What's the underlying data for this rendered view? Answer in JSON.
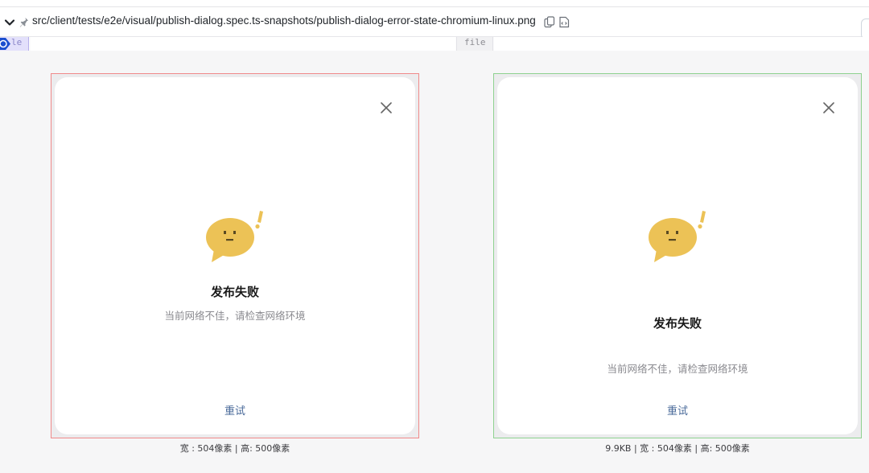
{
  "header": {
    "file_path": "src/client/tests/e2e/visual/publish-dialog.spec.ts-snapshots/publish-dialog-error-state-chromium-linux.png"
  },
  "tabs": {
    "left_label": "le",
    "right_label": "file"
  },
  "left_panel": {
    "dialog": {
      "title": "发布失败",
      "description": "当前网络不佳，请检查网络环境",
      "retry_label": "重试"
    },
    "caption": "宽 : 504像素 | 高: 500像素"
  },
  "right_panel": {
    "dialog": {
      "title": "发布失败",
      "description": "当前网络不佳，请检查网络环境",
      "retry_label": "重试"
    },
    "caption": "9.9KB | 宽 : 504像素 | 高: 500像素"
  },
  "colors": {
    "mascot": "#ecc256",
    "deleted_border": "#f08a8a",
    "added_border": "#8fd28f",
    "retry": "#4a6a9a"
  },
  "icons": {
    "collapse": "chevron-down-icon",
    "pin": "pin-icon",
    "copy": "copy-icon",
    "code": "code-icon",
    "close": "close-icon",
    "mascot": "error-chat-bubble-icon"
  }
}
